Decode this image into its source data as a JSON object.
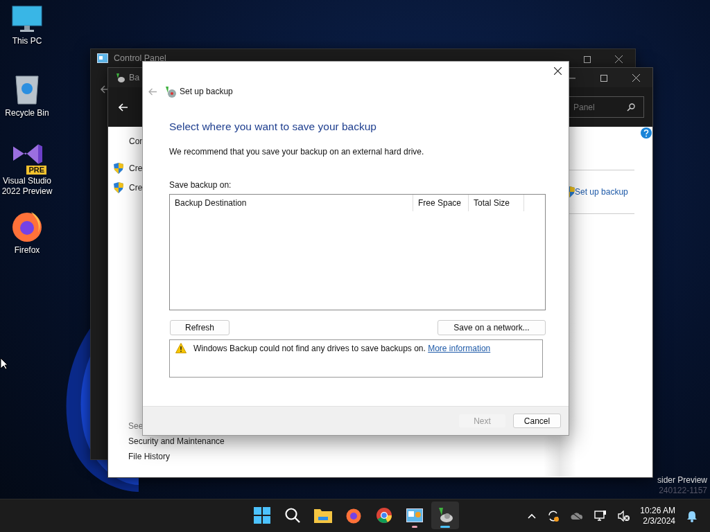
{
  "desktop_icons": [
    {
      "kind": "pc",
      "label": "This PC"
    },
    {
      "kind": "recycle",
      "label": "Recycle Bin"
    },
    {
      "kind": "vs",
      "label": "Visual Studio 2022 Preview",
      "badge": "PRE"
    },
    {
      "kind": "firefox",
      "label": "Firefox"
    }
  ],
  "control_panel_window": {
    "title": "Control Panel"
  },
  "backup_window": {
    "title": "Ba",
    "search": {
      "placeholder": "Panel"
    },
    "left_items": [
      {
        "kind": "plain",
        "label": "Con"
      },
      {
        "kind": "shield",
        "label": "Cre"
      },
      {
        "kind": "shield",
        "label": "Cre"
      }
    ],
    "task_link": "Set up backup",
    "see_also": {
      "heading": "See",
      "links": [
        "Security and Maintenance",
        "File History"
      ]
    }
  },
  "dialog": {
    "title": "Set up backup",
    "heading": "Select where you want to save your backup",
    "description": "We recommend that you save your backup on an external hard drive.",
    "list_label": "Save backup on:",
    "columns": [
      "Backup Destination",
      "Free Space",
      "Total Size"
    ],
    "refresh_button": "Refresh",
    "network_button": "Save on a network...",
    "warning": {
      "text": "Windows Backup could not find any drives to save backups on.",
      "link": "More information"
    },
    "buttons": [
      {
        "label": "Next",
        "disabled": true
      },
      {
        "label": "Cancel",
        "disabled": false
      }
    ]
  },
  "watermark": [
    "sider Preview",
    "240122-1157"
  ],
  "taskbar": {
    "apps": [
      {
        "kind": "start",
        "running": false,
        "selected": false
      },
      {
        "kind": "search",
        "running": false,
        "selected": false
      },
      {
        "kind": "folder",
        "running": false,
        "selected": false
      },
      {
        "kind": "firefox",
        "running": false,
        "selected": false
      },
      {
        "kind": "chrome",
        "running": false,
        "selected": false
      },
      {
        "kind": "control",
        "running": true,
        "selected": false
      },
      {
        "kind": "backup",
        "running": true,
        "selected": true
      }
    ],
    "time": "10:26 AM",
    "date": "2/3/2024"
  }
}
